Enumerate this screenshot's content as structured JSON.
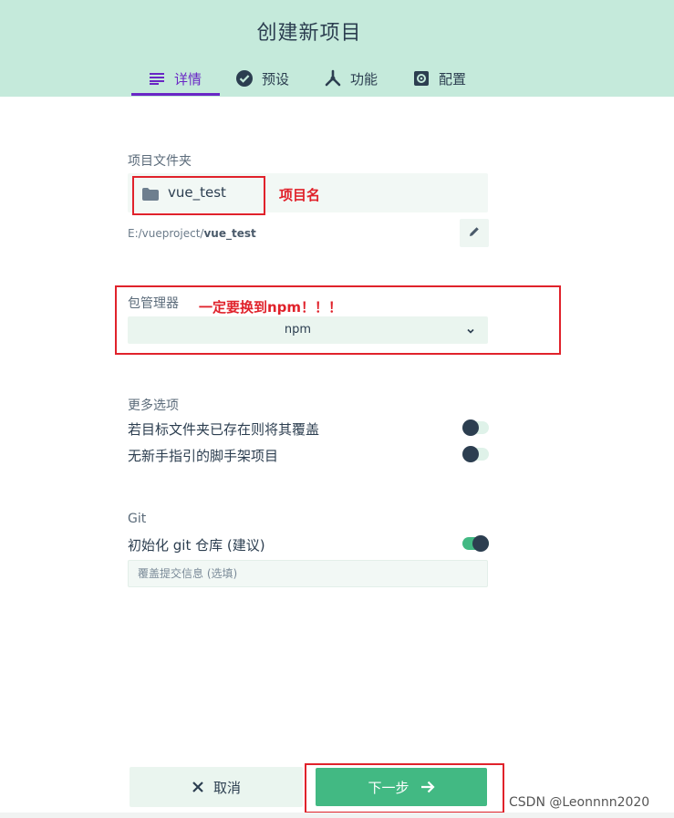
{
  "header": {
    "title": "创建新项目",
    "tabs": [
      {
        "label": "详情",
        "icon": "list-icon",
        "active": true
      },
      {
        "label": "预设",
        "icon": "check-circle-icon",
        "active": false
      },
      {
        "label": "功能",
        "icon": "branch-icon",
        "active": false
      },
      {
        "label": "配置",
        "icon": "settings-icon",
        "active": false
      }
    ]
  },
  "project_folder": {
    "label": "项目文件夹",
    "value": "vue_test",
    "annotation": "项目名",
    "path_prefix": "E:/vueproject/",
    "path_name": "vue_test"
  },
  "package_manager": {
    "label": "包管理器",
    "annotation": "一定要换到npm！！！",
    "value": "npm"
  },
  "more_options": {
    "label": "更多选项",
    "options": [
      {
        "label": "若目标文件夹已存在则将其覆盖",
        "enabled": false
      },
      {
        "label": "无新手指引的脚手架项目",
        "enabled": false
      }
    ]
  },
  "git": {
    "label": "Git",
    "init_label": "初始化 git 仓库 (建议)",
    "init_enabled": true,
    "commit_placeholder": "覆盖提交信息 (选填)"
  },
  "footer": {
    "cancel_label": "取消",
    "next_label": "下一步",
    "watermark": "CSDN @Leonnnn2020"
  },
  "colors": {
    "header_bg": "#c5eadb",
    "accent_purple": "#6a27c5",
    "primary_green": "#42b983",
    "annotation_red": "#e0222b"
  }
}
